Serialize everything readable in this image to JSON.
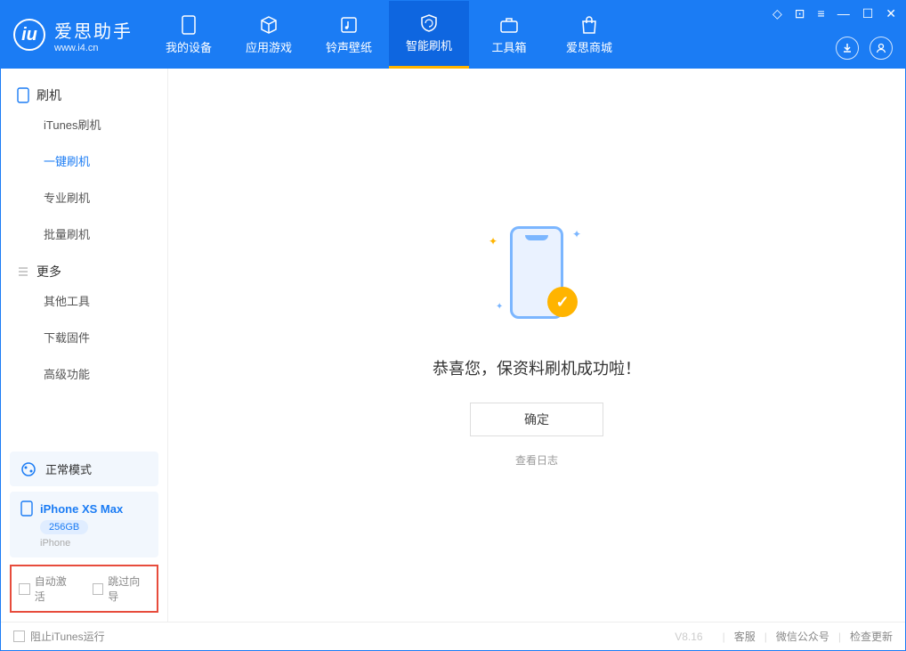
{
  "app": {
    "name": "爱思助手",
    "url": "www.i4.cn"
  },
  "nav": {
    "items": [
      {
        "label": "我的设备"
      },
      {
        "label": "应用游戏"
      },
      {
        "label": "铃声壁纸"
      },
      {
        "label": "智能刷机"
      },
      {
        "label": "工具箱"
      },
      {
        "label": "爱思商城"
      }
    ]
  },
  "sidebar": {
    "group1": {
      "title": "刷机",
      "items": [
        "iTunes刷机",
        "一键刷机",
        "专业刷机",
        "批量刷机"
      ]
    },
    "group2": {
      "title": "更多",
      "items": [
        "其他工具",
        "下载固件",
        "高级功能"
      ]
    },
    "mode": "正常模式",
    "device": {
      "name": "iPhone XS Max",
      "storage": "256GB",
      "type": "iPhone"
    },
    "checkboxes": {
      "auto_activate": "自动激活",
      "skip_guide": "跳过向导"
    }
  },
  "main": {
    "success_text": "恭喜您，保资料刷机成功啦！",
    "ok_button": "确定",
    "view_log": "查看日志"
  },
  "footer": {
    "block_itunes": "阻止iTunes运行",
    "version": "V8.16",
    "links": [
      "客服",
      "微信公众号",
      "检查更新"
    ]
  }
}
